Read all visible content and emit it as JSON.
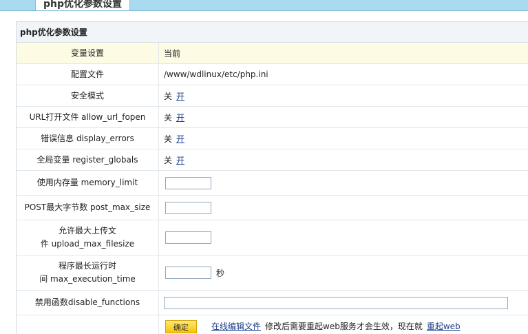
{
  "tab_label": "php优化参数设置",
  "panel_title": "php优化参数设置",
  "header": {
    "label": "变量设置",
    "value": "当前"
  },
  "config_file": {
    "label": "配置文件",
    "value": "/www/wdlinux/etc/php.ini"
  },
  "toggles": [
    {
      "label": "安全模式",
      "off": "关",
      "on": "开"
    },
    {
      "label": "URL打开文件 allow_url_fopen",
      "off": "关",
      "on": "开"
    },
    {
      "label": "错误信息 display_errors",
      "off": "关",
      "on": "开"
    },
    {
      "label": "全局变量 register_globals",
      "off": "关",
      "on": "开"
    }
  ],
  "inputs": {
    "memory_limit": {
      "label": "使用内存量 memory_limit",
      "value": ""
    },
    "post_max_size": {
      "label": "POST最大字节数 post_max_size",
      "value": ""
    },
    "upload_max_filesize": {
      "label_line1": "允许最大上传文",
      "label_line2": "件 upload_max_filesize",
      "value": ""
    },
    "max_execution_time": {
      "label_line1": "程序最长运行时",
      "label_line2": "间 max_execution_time",
      "value": "",
      "unit": "秒"
    },
    "disable_functions": {
      "label": "禁用函数disable_functions",
      "value": ""
    }
  },
  "footer": {
    "confirm_label": "确定",
    "edit_link": "在线编辑文件",
    "note": "修改后需要重起web服务才会生效，现在就",
    "restart_link": "重起web"
  }
}
